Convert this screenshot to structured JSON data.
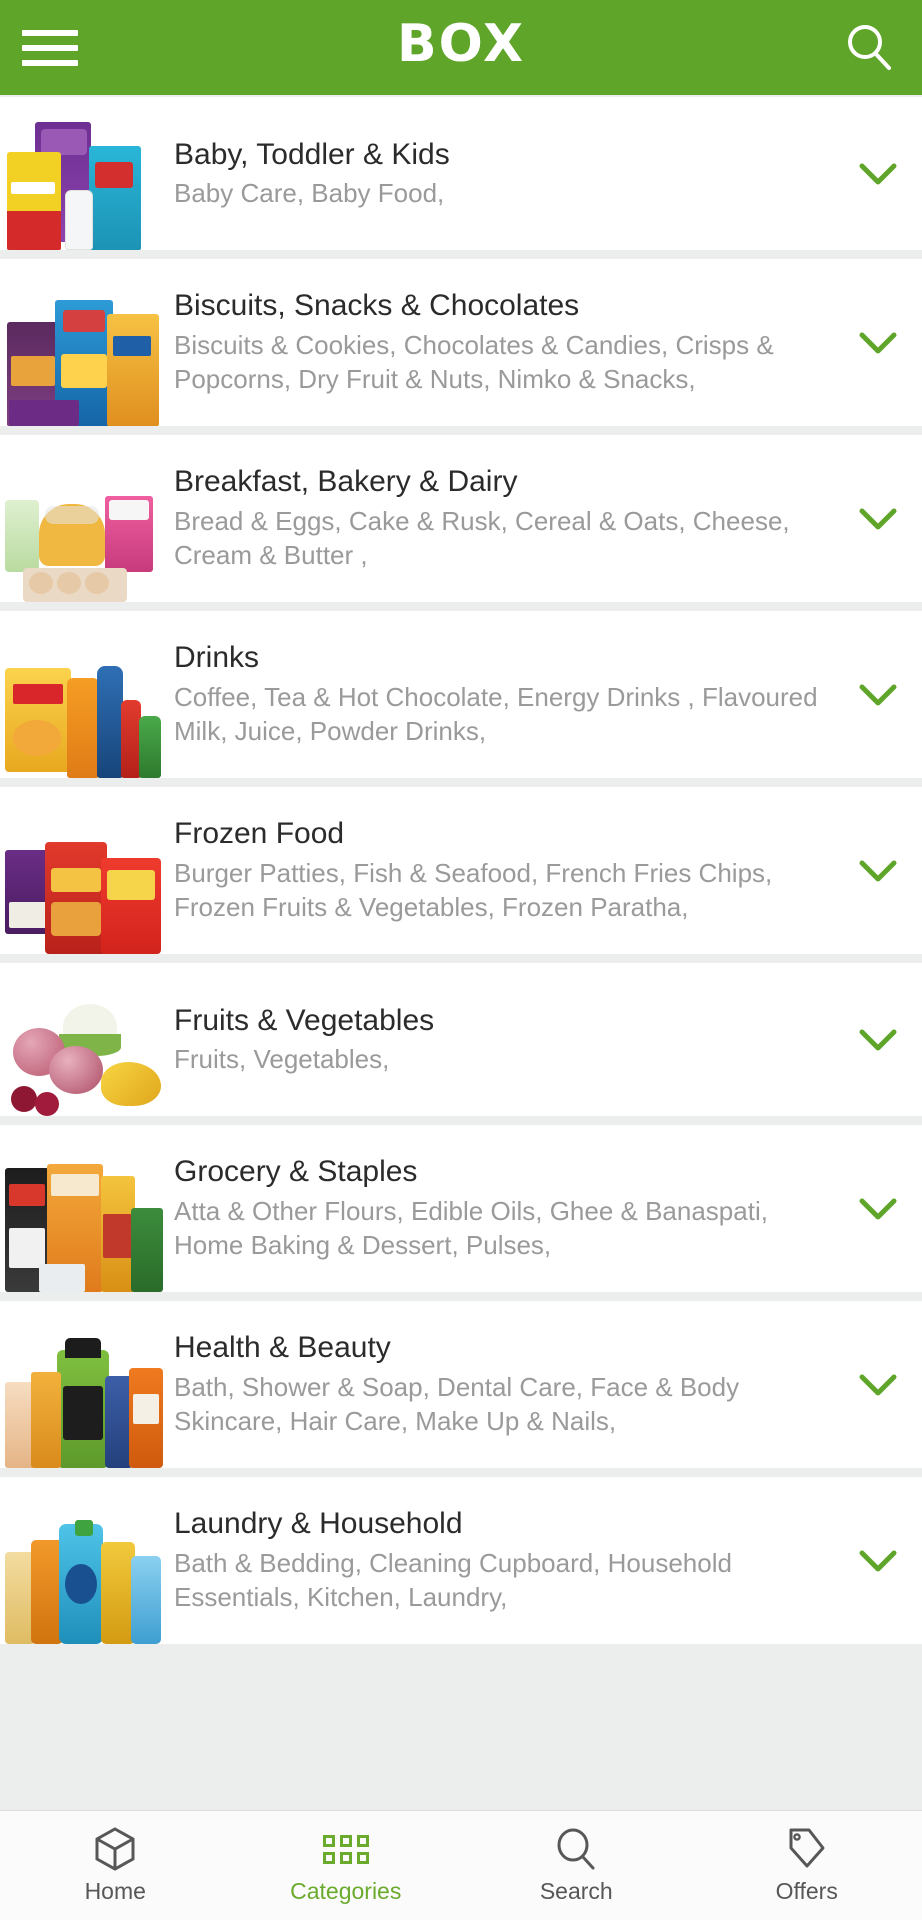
{
  "header": {
    "menu_icon": "hamburger-icon",
    "title": "BOX",
    "search_icon": "search-icon"
  },
  "categories": [
    {
      "title": "Baby, Toddler & Kids",
      "subtitle": "Baby Care, Baby Food,",
      "expand_icon": "chevron-down-icon",
      "thumb_name": "baby-products-thumbnail"
    },
    {
      "title": "Biscuits, Snacks & Chocolates",
      "subtitle": "Biscuits & Cookies, Chocolates & Candies, Crisps & Popcorns, Dry Fruit & Nuts, Nimko & Snacks,",
      "expand_icon": "chevron-down-icon",
      "thumb_name": "snacks-products-thumbnail"
    },
    {
      "title": "Breakfast, Bakery & Dairy",
      "subtitle": "Bread & Eggs, Cake & Rusk, Cereal & Oats, Cheese, Cream & Butter ,",
      "expand_icon": "chevron-down-icon",
      "thumb_name": "bakery-products-thumbnail"
    },
    {
      "title": "Drinks",
      "subtitle": "Coffee, Tea & Hot Chocolate, Energy Drinks , Flavoured Milk, Juice, Powder Drinks,",
      "expand_icon": "chevron-down-icon",
      "thumb_name": "drinks-products-thumbnail"
    },
    {
      "title": "Frozen Food",
      "subtitle": "Burger Patties, Fish & Seafood, French Fries Chips, Frozen Fruits & Vegetables, Frozen Paratha,",
      "expand_icon": "chevron-down-icon",
      "thumb_name": "frozen-food-thumbnail"
    },
    {
      "title": "Fruits & Vegetables",
      "subtitle": "Fruits, Vegetables,",
      "expand_icon": "chevron-down-icon",
      "thumb_name": "fruits-vegetables-thumbnail"
    },
    {
      "title": "Grocery & Staples",
      "subtitle": "Atta & Other Flours, Edible Oils, Ghee & Banaspati, Home Baking & Dessert, Pulses,",
      "expand_icon": "chevron-down-icon",
      "thumb_name": "grocery-staples-thumbnail"
    },
    {
      "title": "Health & Beauty",
      "subtitle": "Bath, Shower & Soap, Dental Care, Face & Body Skincare, Hair Care, Make Up & Nails,",
      "expand_icon": "chevron-down-icon",
      "thumb_name": "health-beauty-thumbnail"
    },
    {
      "title": "Laundry & Household",
      "subtitle": "Bath & Bedding, Cleaning Cupboard, Household Essentials, Kitchen, Laundry,",
      "expand_icon": "chevron-down-icon",
      "thumb_name": "laundry-household-thumbnail"
    }
  ],
  "bottom_nav": [
    {
      "label": "Home",
      "icon": "box-icon",
      "active": false
    },
    {
      "label": "Categories",
      "icon": "grid-icon",
      "active": true
    },
    {
      "label": "Search",
      "icon": "search-icon",
      "active": false
    },
    {
      "label": "Offers",
      "icon": "tag-icon",
      "active": false
    }
  ],
  "colors": {
    "brand_green": "#5fa52a",
    "accent_green": "#6aab2e",
    "title_text": "#2b2b2b",
    "subtitle_text": "#9a9a9a",
    "page_bg": "#eceded",
    "card_bg": "#ffffff"
  }
}
